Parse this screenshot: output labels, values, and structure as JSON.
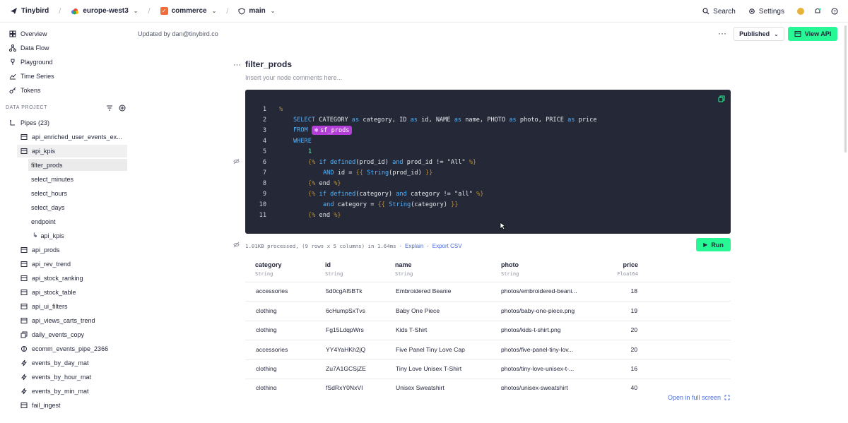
{
  "topbar": {
    "brand": "Tinybird",
    "region": "europe-west3",
    "workspace": "commerce",
    "branch": "main",
    "search": "Search",
    "settings": "Settings"
  },
  "nav": {
    "items": [
      {
        "label": "Overview",
        "icon": "overview-icon"
      },
      {
        "label": "Data Flow",
        "icon": "data-flow-icon"
      },
      {
        "label": "Playground",
        "icon": "playground-icon"
      },
      {
        "label": "Time Series",
        "icon": "time-series-icon"
      },
      {
        "label": "Tokens",
        "icon": "key-icon"
      }
    ]
  },
  "project": {
    "section_title": "DATA PROJECT",
    "pipes_label": "Pipes (23)",
    "pipes": [
      "api_enriched_user_events_ex...",
      "api_kpis",
      "filter_prods",
      "select_minutes",
      "select_hours",
      "select_days",
      "endpoint",
      "api_kpis",
      "api_prods",
      "api_rev_trend",
      "api_stock_ranking",
      "api_stock_table",
      "api_ui_filters",
      "api_views_carts_trend",
      "daily_events_copy",
      "ecomm_events_pipe_2366",
      "events_by_day_mat",
      "events_by_hour_mat",
      "events_by_min_mat",
      "fail_ingest"
    ]
  },
  "header": {
    "updated_by": "Updated by dan@tinybird.co",
    "publish_state": "Published",
    "view_api": "View API"
  },
  "node": {
    "title": "filter_prods",
    "comment_placeholder": "Insert your node comments here...",
    "code_lines": [
      "1",
      "2",
      "3",
      "4",
      "5",
      "6",
      "7",
      "8",
      "9",
      "10",
      "11"
    ],
    "chip_label": "sf_prods"
  },
  "result": {
    "stats": "1.01KB processed, (9 rows x 5 columns) in 1.64ms",
    "explain": "Explain",
    "export": "Export CSV",
    "run": "Run",
    "full_screen": "Open in full screen",
    "columns": [
      {
        "name": "category",
        "type": "String"
      },
      {
        "name": "id",
        "type": "String"
      },
      {
        "name": "name",
        "type": "String"
      },
      {
        "name": "photo",
        "type": "String"
      },
      {
        "name": "price",
        "type": "Float64"
      }
    ],
    "rows": [
      [
        "accessories",
        "5d0cgAI5BTk",
        "Embroidered Beanie",
        "photos/embroidered-beani...",
        "18"
      ],
      [
        "clothing",
        "6cHumpSxTvs",
        "Baby One Piece",
        "photos/baby-one-piece.png",
        "19"
      ],
      [
        "clothing",
        "Fg15LdqpWrs",
        "Kids T-Shirt",
        "photos/kids-t-shirt.png",
        "20"
      ],
      [
        "accessories",
        "YY4YaHKh2jQ",
        "Five Panel Tiny Love Cap",
        "photos/five-panel-tiny-lov...",
        "20"
      ],
      [
        "clothing",
        "Zu7A1GCSjZE",
        "Tiny Love Unisex T-Shirt",
        "photos/tiny-love-unisex-t-...",
        "16"
      ],
      [
        "clothing",
        "fSdRxY0NxVI",
        "Unisex Sweatshirt",
        "photos/unisex-sweatshirt",
        "40"
      ]
    ]
  },
  "colors": {
    "accent": "#27f795",
    "editor_bg": "#252837",
    "node_chip": "#b240d6",
    "keyword": "#4fb3ff",
    "link": "#4a6fd9"
  }
}
